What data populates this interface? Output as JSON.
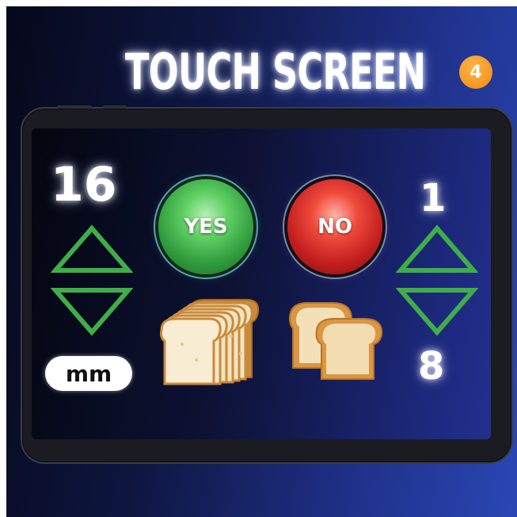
{
  "header": {
    "title": "TOUCH SCREEN",
    "step_badge": "4"
  },
  "screen": {
    "thickness": {
      "value": "16",
      "unit": "mm"
    },
    "quantity": {
      "min_label": "1",
      "max_label": "8"
    },
    "confirm": {
      "yes_label": "YES",
      "no_label": "NO"
    },
    "icons": [
      "up-arrow-icon",
      "down-arrow-icon",
      "sliced-bread-icon",
      "bread-loaf-icon"
    ]
  },
  "colors": {
    "arrow_green": "#3fae49",
    "yes_green": "#3aaa45",
    "no_red": "#d42a24",
    "badge_orange": "#f5931f",
    "background_blue": "#2a47b4"
  }
}
